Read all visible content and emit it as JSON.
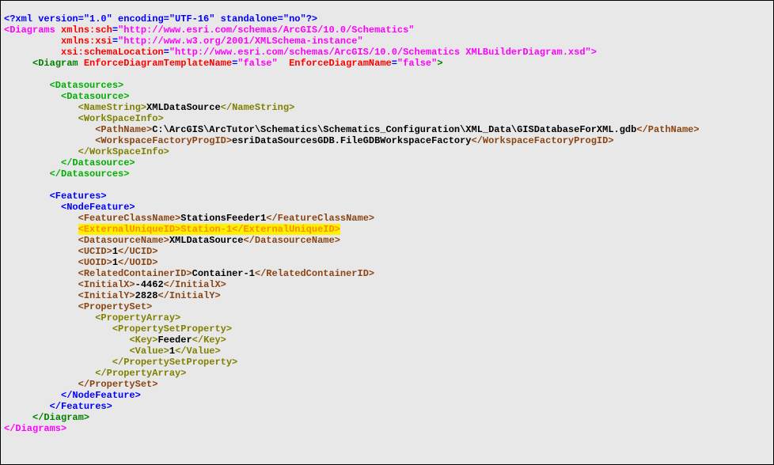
{
  "xml_decl": {
    "open": "<?xml",
    "attrs": "version=\"1.0\" encoding=\"UTF-16\" standalone=\"no\"",
    "close": "?>"
  },
  "diagrams_open": {
    "tag_open": "<Diagrams",
    "a1n": "xmlns:sch",
    "a1v": "\"http://www.esri.com/schemas/ArcGIS/10.0/Schematics\"",
    "a2n": "xmlns:xsi",
    "a2v": "\"http://www.w3.org/2001/XMLSchema-instance\"",
    "a3n": "xsi:schemaLocation",
    "a3v": "\"http://www.esri.com/schemas/ArcGIS/10.0/Schematics XMLBuilderDiagram.xsd\"",
    "tag_close_gt": ">"
  },
  "diagram_open": {
    "tag_open": "<Diagram",
    "a1n": "EnforceDiagramTemplateName",
    "a1v": "\"false\"",
    "a2n": "EnforceDiagramName",
    "a2v": "\"false\"",
    "gt": ">"
  },
  "datasources_open": "<Datasources>",
  "datasource_open": "<Datasource>",
  "namestring_open": "<NameString>",
  "namestring_val": "XMLDataSource",
  "namestring_close": "</NameString>",
  "workspaceinfo_open": "<WorkSpaceInfo>",
  "pathname_open": "<PathName>",
  "pathname_val": "C:\\ArcGIS\\ArcTutor\\Schematics\\Schematics_Configuration\\XML_Data\\GISDatabaseForXML.gdb",
  "pathname_close": "</PathName>",
  "wfprogid_open": "<WorkspaceFactoryProgID>",
  "wfprogid_val": "esriDataSourcesGDB.FileGDBWorkspaceFactory",
  "wfprogid_close": "</WorkspaceFactoryProgID>",
  "workspaceinfo_close": "</WorkSpaceInfo>",
  "datasource_close": "</Datasource>",
  "datasources_close": "</Datasources>",
  "features_open": "<Features>",
  "nodefeature_open": "<NodeFeature>",
  "featureclassname_open": "<FeatureClassName>",
  "featureclassname_val": "StationsFeeder1",
  "featureclassname_close": "</FeatureClassName>",
  "externaluniqueid_open": "<ExternalUniqueID>",
  "externaluniqueid_val": "Station-1",
  "externaluniqueid_close": "</ExternalUniqueID>",
  "datasourcename_open": "<DatasourceName>",
  "datasourcename_val": "XMLDataSource",
  "datasourcename_close": "</DatasourceName>",
  "ucid_open": "<UCID>",
  "ucid_val": "1",
  "ucid_close": "</UCID>",
  "uoid_open": "<UOID>",
  "uoid_val": "1",
  "uoid_close": "</UOID>",
  "relcont_open": "<RelatedContainerID>",
  "relcont_val": "Container-1",
  "relcont_close": "</RelatedContainerID>",
  "initx_open": "<InitialX>",
  "initx_val": "-4462",
  "initx_close": "</InitialX>",
  "inity_open": "<InitialY>",
  "inity_val": "2828",
  "inity_close": "</InitialY>",
  "propset_open": "<PropertySet>",
  "proparr_open": "<PropertyArray>",
  "propsetprop_open": "<PropertySetProperty>",
  "key_open": "<Key>",
  "key_val": "Feeder",
  "key_close": "</Key>",
  "value_open": "<Value>",
  "value_val": "1",
  "value_close": "</Value>",
  "propsetprop_close": "</PropertySetProperty>",
  "proparr_close": "</PropertyArray>",
  "propset_close": "</PropertySet>",
  "nodefeature_close": "</NodeFeature>",
  "features_close": "</Features>",
  "diagram_close": "</Diagram>",
  "diagrams_close": "</Diagrams>"
}
